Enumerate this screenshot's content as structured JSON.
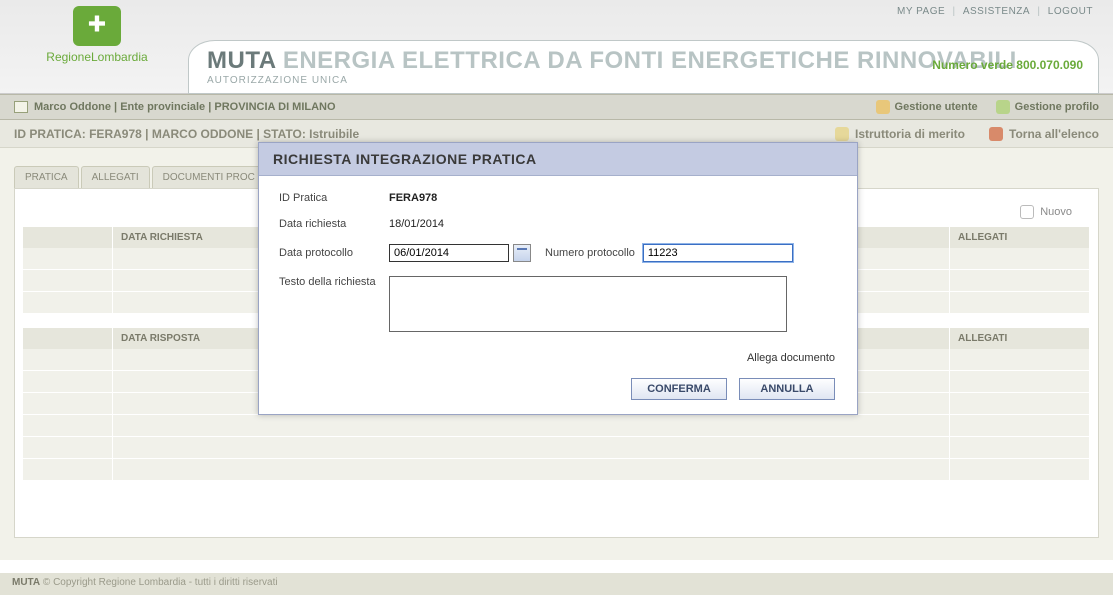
{
  "topLinks": {
    "myPage": "MY PAGE",
    "assistenza": "ASSISTENZA",
    "logout": "LOGOUT"
  },
  "brand": {
    "region": "RegioneLombardia"
  },
  "titleBand": {
    "muta": "MUTA",
    "rest": "ENERGIA ELETTRICA DA FONTI ENERGETICHE RINNOVABILI",
    "sub": "AUTORIZZAZIONE UNICA",
    "numeroVerde": "Numero verde 800.070.090"
  },
  "userBar": {
    "text": "Marco Oddone | Ente provinciale | PROVINCIA DI MILANO",
    "rightA": "Gestione utente",
    "rightB": "Gestione profilo"
  },
  "contextBar": {
    "left": "ID PRATICA: FERA978 | MARCO ODDONE | STATO: Istruibile",
    "rightA": "Istruttoria di merito",
    "rightB": "Torna all'elenco"
  },
  "tabs": {
    "t1": "PRATICA",
    "t2": "ALLEGATI",
    "t3": "DOCUMENTI PROC"
  },
  "nuovo": "Nuovo",
  "gridHeaders": {
    "dataRichiesta": "DATA RICHIESTA",
    "dataRisposta": "DATA RISPOSTA",
    "allegati": "ALLEGATI"
  },
  "modal": {
    "title": "RICHIESTA INTEGRAZIONE PRATICA",
    "labels": {
      "idPratica": "ID Pratica",
      "dataRichiesta": "Data richiesta",
      "dataProtocollo": "Data protocollo",
      "numeroProtocollo": "Numero protocollo",
      "testo": "Testo della richiesta",
      "allega": "Allega documento"
    },
    "values": {
      "idPratica": "FERA978",
      "dataRichiesta": "18/01/2014",
      "dataProtocollo": "06/01/2014",
      "numeroProtocollo": "11223",
      "testo": ""
    },
    "buttons": {
      "conferma": "CONFERMA",
      "annulla": "ANNULLA"
    }
  },
  "footer": {
    "brand": "MUTA",
    "rest": " © Copyright Regione Lombardia - tutti i diritti riservati"
  }
}
